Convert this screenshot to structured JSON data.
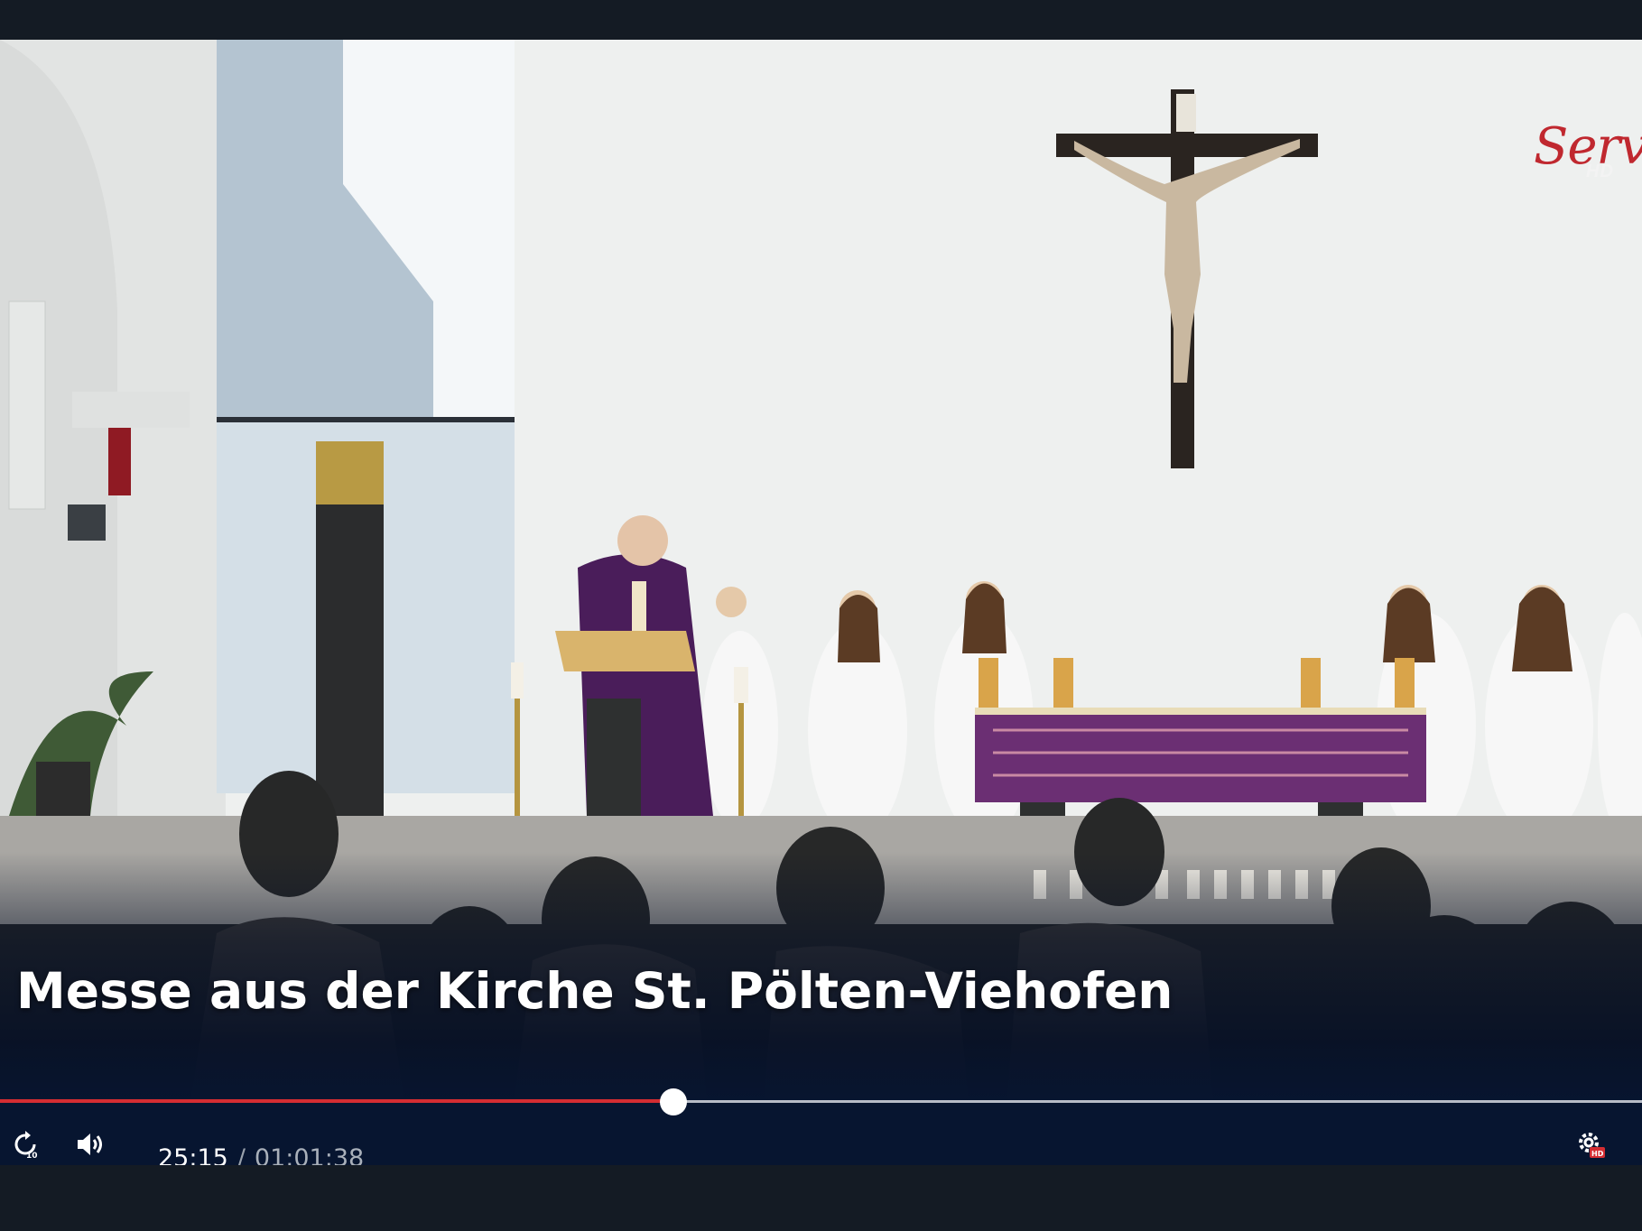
{
  "video": {
    "title": "Messe aus der Kirche St. Pölten-Viehofen",
    "channel_logo": {
      "text": "Servus",
      "badge": "HD"
    }
  },
  "player": {
    "progress_fraction": 0.41,
    "current_time": "25:15",
    "time_separator": "/",
    "total_time": "01:01:38",
    "controls": [
      {
        "name": "replay-10-icon",
        "badge": "10"
      },
      {
        "name": "volume-icon"
      },
      {
        "name": "settings-hd-icon",
        "badge": "HD"
      }
    ]
  },
  "colors": {
    "accent": "#d52d32",
    "overlay": "#071530",
    "chrome": "#141b24"
  }
}
